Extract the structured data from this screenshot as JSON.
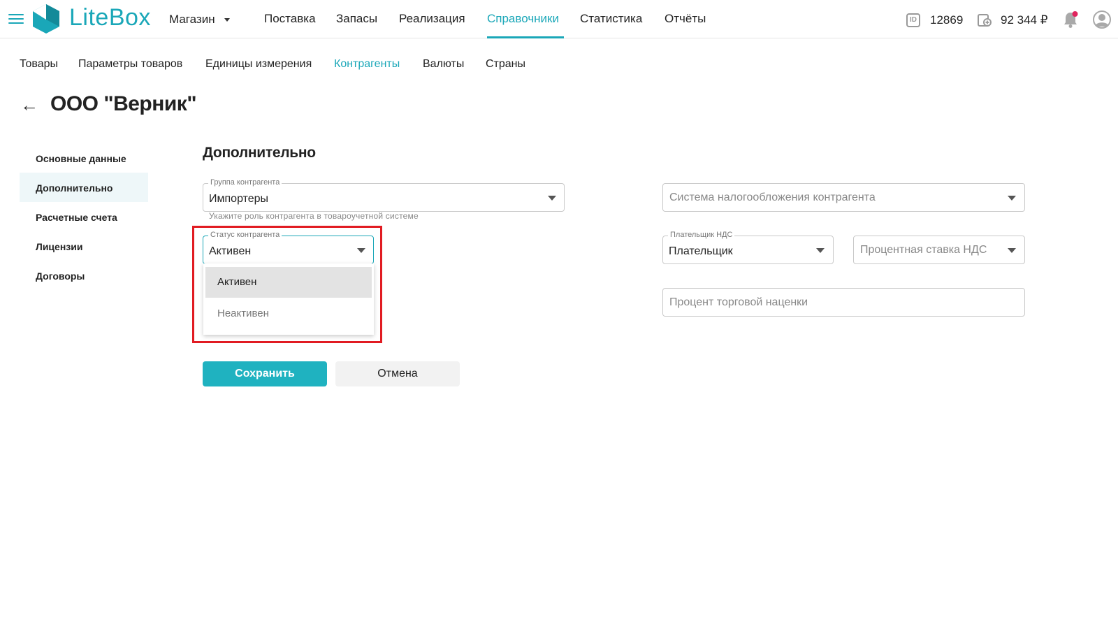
{
  "header": {
    "logo_text": "LiteBox",
    "store_label": "Магазин",
    "nav": [
      "Поставка",
      "Запасы",
      "Реализация",
      "Справочники",
      "Статистика",
      "Отчёты"
    ],
    "active_nav": "Справочники",
    "id_badge": "ID",
    "id_value": "12869",
    "balance": "92 344 ₽",
    "brand_color": "#1aa7b8",
    "notification_dot_color": "#e0245e"
  },
  "subnav": {
    "items": [
      "Товары",
      "Параметры товаров",
      "Единицы измерения",
      "Контрагенты",
      "Валюты",
      "Страны"
    ],
    "active": "Контрагенты"
  },
  "page": {
    "back_arrow": "←",
    "title": "ООО \"Верник\""
  },
  "sidenav": {
    "items": [
      "Основные данные",
      "Дополнительно",
      "Расчетные счета",
      "Лицензии",
      "Договоры"
    ],
    "active": "Дополнительно"
  },
  "section": {
    "title": "Дополнительно"
  },
  "form": {
    "group": {
      "label": "Группа контрагента",
      "value": "Импортеры",
      "helper": "Укажите роль контрагента в товароучетной системе"
    },
    "status": {
      "label": "Статус контрагента",
      "value": "Активен",
      "options": [
        "Активен",
        "Неактивен"
      ]
    },
    "tax_system": {
      "placeholder": "Система налогообложения контрагента"
    },
    "vat_payer": {
      "label": "Плательщик НДС",
      "value": "Плательщик"
    },
    "vat_rate": {
      "placeholder": "Процентная ставка НДС"
    },
    "markup": {
      "placeholder": "Процент торговой наценки"
    }
  },
  "actions": {
    "save": "Сохранить",
    "cancel": "Отмена"
  },
  "highlight_color": "#e11b22"
}
